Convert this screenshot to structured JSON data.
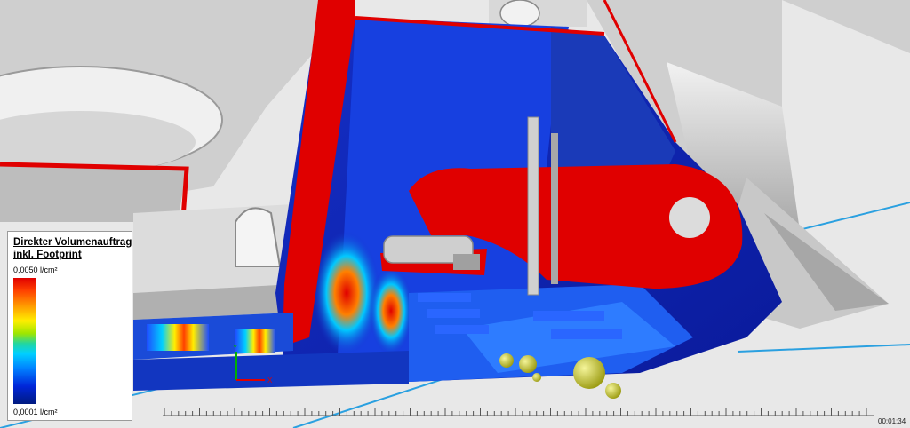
{
  "legend": {
    "title_line1": "Direkter Volumenauftrag",
    "title_line2": "inkl. Footprint",
    "max_label": "0,0050 l/cm²",
    "min_label": "0,0001 l/cm²",
    "colors": [
      "#e00000",
      "#ff9900",
      "#ffee00",
      "#22d6a0",
      "#00d0ff",
      "#0080ff",
      "#001a80"
    ]
  },
  "viewer": {
    "timestamp": "00:01:34",
    "axis_y_label": "Y",
    "axis_x_label": "X"
  }
}
